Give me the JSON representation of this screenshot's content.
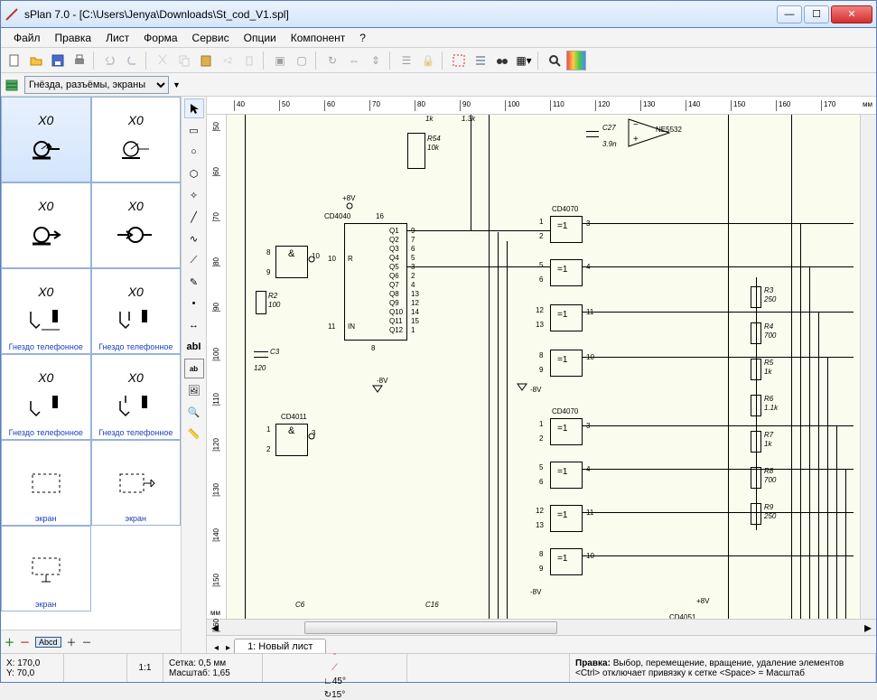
{
  "window": {
    "title": "sPlan 7.0 - [C:\\Users\\Jenya\\Downloads\\St_cod_V1.spl]"
  },
  "menu": [
    "Файл",
    "Правка",
    "Лист",
    "Форма",
    "Сервис",
    "Опции",
    "Компонент",
    "?"
  ],
  "library": {
    "selected": "Гнёзда, разъёмы, экраны"
  },
  "components": [
    {
      "label": "X0",
      "caption": "",
      "kind": "jack-right"
    },
    {
      "label": "X0",
      "caption": "",
      "kind": "jack-right-thin"
    },
    {
      "label": "X0",
      "caption": "",
      "kind": "jack-arrow"
    },
    {
      "label": "X0",
      "caption": "",
      "kind": "jack-cross"
    },
    {
      "label": "X0",
      "caption": "Гнездо телефонное",
      "kind": "phone-jack-a"
    },
    {
      "label": "X0",
      "caption": "Гнездо телефонное",
      "kind": "phone-jack-b"
    },
    {
      "label": "X0",
      "caption": "Гнездо телефонное",
      "kind": "phone-jack-c"
    },
    {
      "label": "X0",
      "caption": "Гнездо телефонное",
      "kind": "phone-jack-d"
    },
    {
      "label": "",
      "caption": "экран",
      "kind": "shield"
    },
    {
      "label": "",
      "caption": "экран",
      "kind": "shield-gnd"
    },
    {
      "label": "",
      "caption": "экран",
      "kind": "shield-c"
    }
  ],
  "ruler": {
    "h_ticks": [
      "40",
      "50",
      "60",
      "70",
      "80",
      "90",
      "100",
      "110",
      "120",
      "130",
      "140",
      "150",
      "160",
      "170"
    ],
    "h_unit": "мм",
    "v_ticks": [
      "50",
      "60",
      "70",
      "80",
      "90",
      "100",
      "110",
      "120",
      "130",
      "140",
      "150",
      "160"
    ],
    "v_unit": "мм"
  },
  "tab": {
    "label": "1: Новый лист"
  },
  "status": {
    "x_label": "X:",
    "x": "170,0",
    "y_label": "Y:",
    "y": "70,0",
    "ratio": "1:1",
    "grid_label": "Сетка:",
    "grid": "0,5 мм",
    "scale_label": "Масштаб:",
    "scale": "1,65",
    "angle1": "45°",
    "angle2": "15°",
    "help_title": "Правка:",
    "help": "Выбор, перемещение, вращение, удаление элементов",
    "hint": "<Ctrl> отключает привязку к сетке <Space> = Масштаб"
  },
  "schematic": {
    "opamp": "NE5532",
    "r54": "R54",
    "r54v": "10k",
    "c27": "C27",
    "c27v": "3.9n",
    "plus8v": "+8V",
    "minus8v": "-8V",
    "cd4040": "CD4040",
    "cd4011": "CD4011",
    "cd4070a": "CD4070",
    "cd4070b": "CD4070",
    "cd4051": "CD4051",
    "r2": "R2",
    "r2v": "100",
    "c3": "C3",
    "c3v": "120",
    "c6": "C6",
    "c16": "C16",
    "k1": "1k",
    "k13": "1.3k",
    "r3": "R3",
    "r3v": "250",
    "r4": "R4",
    "r4v": "700",
    "r5": "R5",
    "r5v": "1k",
    "r6": "R6",
    "r6v": "1.1k",
    "r7": "R7",
    "r7v": "1k",
    "r8": "R8",
    "r8v": "700",
    "r9": "R9",
    "r9v": "250",
    "eq": "=1",
    "amp": "&",
    "pins_4040": [
      "Q1",
      "Q2",
      "Q3",
      "Q4",
      "Q5",
      "Q6",
      "Q7",
      "Q8",
      "Q9",
      "Q10",
      "Q11",
      "Q12"
    ],
    "pins_4040n": [
      "9",
      "7",
      "6",
      "5",
      "3",
      "2",
      "4",
      "13",
      "12",
      "14",
      "15",
      "1"
    ],
    "pin16": "16",
    "pin10": "10",
    "pin11": "11",
    "pin8": "8",
    "p1": "1",
    "p2": "2",
    "p3": "3",
    "p4": "4",
    "p5": "5",
    "p6": "6",
    "p8": "8",
    "p9": "9",
    "p10": "10",
    "p11": "11",
    "p12": "12",
    "p13": "13",
    "in": "IN",
    "r_sym": "R"
  }
}
